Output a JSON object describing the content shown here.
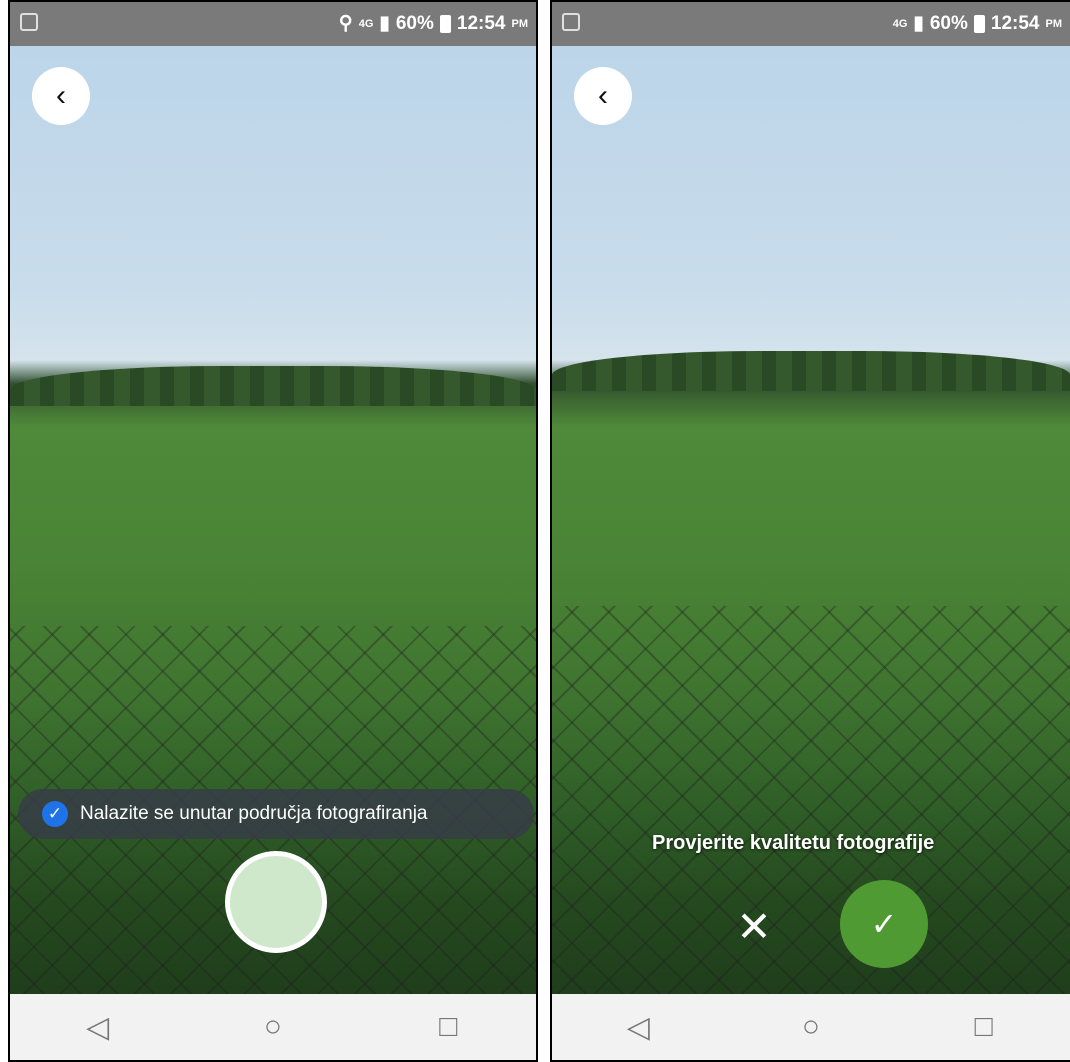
{
  "left_screen": {
    "status_bar": {
      "network": "4G",
      "battery_percent": "60%",
      "time": "12:54",
      "time_suffix": "PM",
      "location_icon": "location-pin-icon"
    },
    "back_icon": "chevron-left-icon",
    "location_notice": {
      "icon": "checkmark-icon",
      "text": "Nalazite se unutar područja fotografiranja",
      "icon_color": "#1e73e8"
    },
    "shutter": {
      "color": "#cfe8cc"
    },
    "nav": {
      "back": "◁",
      "home": "○",
      "recents": "□"
    }
  },
  "right_screen": {
    "status_bar": {
      "network": "4G",
      "battery_percent": "60%",
      "time": "12:54",
      "time_suffix": "PM"
    },
    "back_icon": "chevron-left-icon",
    "review_prompt": "Provjerite kvalitetu fotografije",
    "reject_icon": "close-icon",
    "accept_icon": "checkmark-icon",
    "accept_color": "#4f9a33",
    "nav": {
      "back": "◁",
      "home": "○",
      "recents": "□"
    }
  }
}
